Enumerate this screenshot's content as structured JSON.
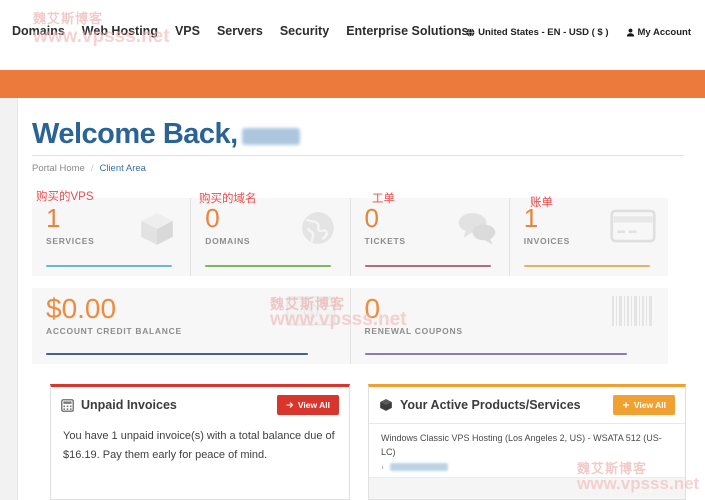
{
  "nav": {
    "links": [
      {
        "label": "Domains"
      },
      {
        "label": "Web Hosting"
      },
      {
        "label": "VPS"
      },
      {
        "label": "Servers"
      },
      {
        "label": "Security"
      },
      {
        "label": "Enterprise Solutions"
      }
    ],
    "locale": "United States - EN - USD ( $ )",
    "account": "My Account",
    "locale_icon": "globe-icon",
    "account_icon": "user-icon"
  },
  "header": {
    "welcome_prefix": "Welcome Back,",
    "welcome_name_redacted": true
  },
  "breadcrumb": {
    "home": "Portal Home",
    "separator": "/",
    "current": "Client Area"
  },
  "callouts": [
    {
      "text": "购买的VPS",
      "meaning": "purchased-vps"
    },
    {
      "text": "购买的域名",
      "meaning": "purchased-domains"
    },
    {
      "text": "工单",
      "meaning": "tickets"
    },
    {
      "text": "账单",
      "meaning": "invoices"
    }
  ],
  "stats": [
    {
      "value": "1",
      "label": "SERVICES",
      "bar_color": "#6ab7dd",
      "icon": "cube-icon"
    },
    {
      "value": "0",
      "label": "DOMAINS",
      "bar_color": "#7fb560",
      "icon": "globe-icon"
    },
    {
      "value": "0",
      "label": "TICKETS",
      "bar_color": "#b5697c",
      "icon": "comments-icon"
    },
    {
      "value": "1",
      "label": "INVOICES",
      "bar_color": "#e3b45f",
      "icon": "credit-card-icon"
    }
  ],
  "balances": [
    {
      "value": "$0.00",
      "label": "ACCOUNT CREDIT BALANCE",
      "bar_color": "#44638c",
      "icon": "money-bill-icon"
    },
    {
      "value": "0",
      "label": "RENEWAL COUPONS",
      "bar_color": "#8b7bb0",
      "icon": "barcode-icon"
    }
  ],
  "unpaid_invoices": {
    "title": "Unpaid Invoices",
    "title_icon": "calculator-icon",
    "button_label": "View All",
    "button_icon": "arrow-right-icon",
    "body": "You have 1 unpaid invoice(s) with a total balance due of $16.19. Pay them early for peace of mind."
  },
  "active_products": {
    "title": "Your Active Products/Services",
    "title_icon": "cube-icon",
    "button_label": "View All",
    "button_icon": "plus-icon",
    "items": [
      {
        "name": "Windows Classic VPS Hosting (Los Angeles 2, US) - WSATA 512 (US-LC)",
        "ip_redacted": true
      }
    ]
  },
  "watermarks": {
    "cn": "魏艾斯博客",
    "url": "www.vpsss.net"
  },
  "colors": {
    "brand_orange": "#eb7a3c",
    "accent_blue": "#2a6496",
    "stat_orange": "#e8843c",
    "red": "#d9352c",
    "amber": "#f0a132"
  }
}
